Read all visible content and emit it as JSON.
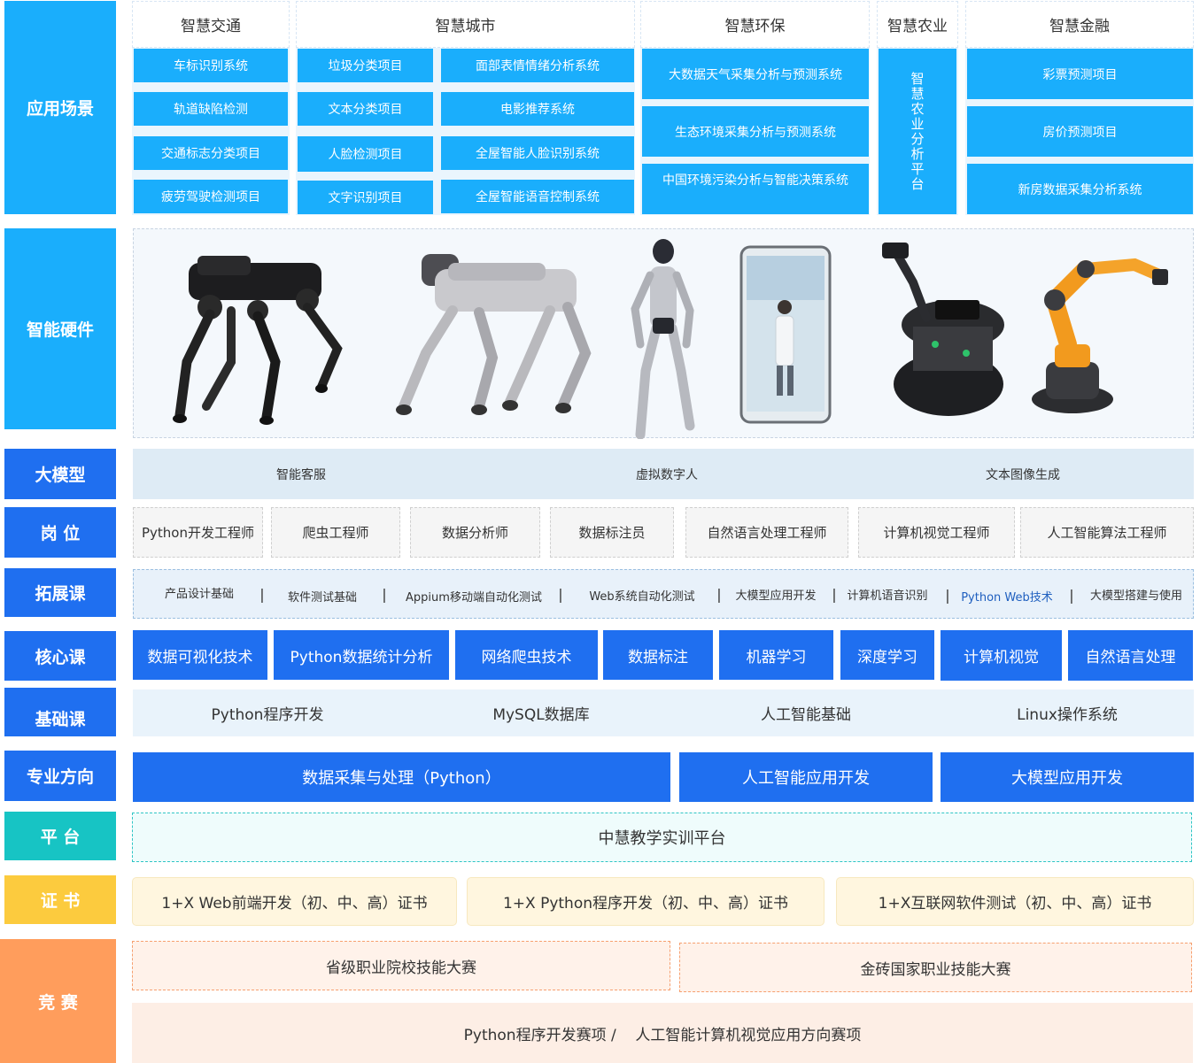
{
  "rows": {
    "scenarios": "应用场景",
    "hardware": "智能硬件",
    "llm": "大模型",
    "jobs": "岗 位",
    "extension": "拓展课",
    "core": "核心课",
    "basic": "基础课",
    "major": "专业方向",
    "platform": "平 台",
    "certificate": "证 书",
    "competition": "竞 赛"
  },
  "scenarios": {
    "traffic": {
      "title": "智慧交通",
      "items": [
        "车标识别系统",
        "轨道缺陷检测",
        "交通标志分类项目",
        "疲劳驾驶检测项目"
      ]
    },
    "city": {
      "title": "智慧城市",
      "left": [
        "垃圾分类项目",
        "文本分类项目",
        "人脸检测项目",
        "文字识别项目"
      ],
      "right": [
        "面部表情情绪分析系统",
        "电影推荐系统",
        "全屋智能人脸识别系统",
        "全屋智能语音控制系统"
      ]
    },
    "env": {
      "title": "智慧环保",
      "items": [
        "大数据天气采集分析与预测系统",
        "生态环境采集分析与预测系统",
        "中国环境污染分析与智能决策系统"
      ]
    },
    "agri": {
      "title": "智慧农业",
      "vertical": "智慧农业分析平台"
    },
    "finance": {
      "title": "智慧金融",
      "items": [
        "彩票预测项目",
        "房价预测项目",
        "新房数据采集分析系统"
      ]
    }
  },
  "hardware_icons": [
    "black-robot-dog-icon",
    "silver-robot-dog-icon",
    "humanoid-robot-icon",
    "virtual-human-display-icon",
    "mobile-robot-arm-platform-icon",
    "orange-robot-arm-icon"
  ],
  "llm": [
    "智能客服",
    "虚拟数字人",
    "文本图像生成"
  ],
  "jobs": [
    "Python开发工程师",
    "爬虫工程师",
    "数据分析师",
    "数据标注员",
    "自然语言处理工程师",
    "计算机视觉工程师",
    "人工智能算法工程师"
  ],
  "extension": [
    "产品设计基础",
    "软件测试基础",
    "Appium移动端自动化测试",
    "Web系统自动化测试",
    "大模型应用开发",
    "计算机语音识别",
    "Python Web技术",
    "大模型搭建与使用"
  ],
  "separator": "|",
  "core": [
    "数据可视化技术",
    "Python数据统计分析",
    "网络爬虫技术",
    "数据标注",
    "机器学习",
    "深度学习",
    "计算机视觉",
    "自然语言处理"
  ],
  "basic": [
    "Python程序开发",
    "MySQL数据库",
    "人工智能基础",
    "Linux操作系统"
  ],
  "major": [
    "数据采集与处理（Python）",
    "人工智能应用开发",
    "大模型应用开发"
  ],
  "platform": "中慧教学实训平台",
  "certificates": [
    "1+X Web前端开发（初、中、高）证书",
    "1+X Python程序开发（初、中、高）证书",
    "1+X互联网软件测试（初、中、高）证书"
  ],
  "competition": {
    "top": [
      "省级职业院校技能大赛",
      "金砖国家职业技能大赛"
    ],
    "bottom": "Python程序开发赛项 /    人工智能计算机视觉应用方向赛项"
  },
  "colors": {
    "cyan": "#1aaefc",
    "blue": "#1f6ff0",
    "teal": "#17c4c4",
    "yellow": "#fccb3e",
    "orange": "#ff9d5c",
    "highlight": "#1f5fbf"
  }
}
